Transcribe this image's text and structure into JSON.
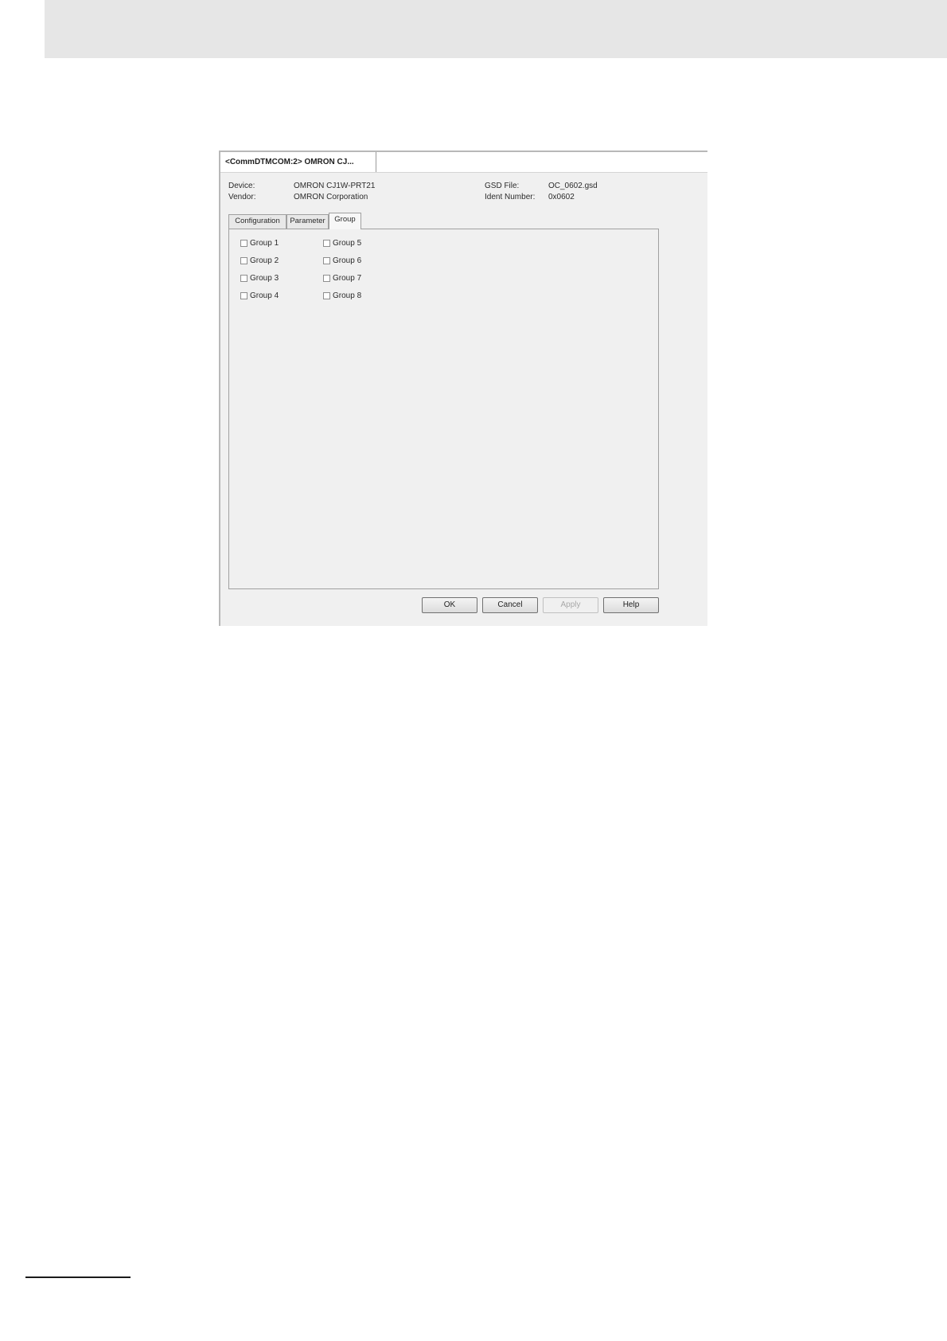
{
  "window": {
    "doc_tab_label": "<CommDTMCOM:2> OMRON CJ..."
  },
  "device_info": {
    "device_label": "Device:",
    "device_value": "OMRON CJ1W-PRT21",
    "vendor_label": "Vendor:",
    "vendor_value": "OMRON Corporation",
    "gsd_label": "GSD File:",
    "gsd_value": "OC_0602.gsd",
    "ident_label": "Ident Number:",
    "ident_value": "0x0602"
  },
  "tabs": [
    {
      "label": "Configuration",
      "active": false
    },
    {
      "label": "Parameter",
      "active": false
    },
    {
      "label": "Group",
      "active": true
    }
  ],
  "groups": [
    {
      "label": "Group 1",
      "checked": false
    },
    {
      "label": "Group 2",
      "checked": false
    },
    {
      "label": "Group 3",
      "checked": false
    },
    {
      "label": "Group 4",
      "checked": false
    },
    {
      "label": "Group 5",
      "checked": false
    },
    {
      "label": "Group 6",
      "checked": false
    },
    {
      "label": "Group 7",
      "checked": false
    },
    {
      "label": "Group 8",
      "checked": false
    }
  ],
  "buttons": {
    "ok": "OK",
    "cancel": "Cancel",
    "apply": "Apply",
    "help": "Help"
  }
}
